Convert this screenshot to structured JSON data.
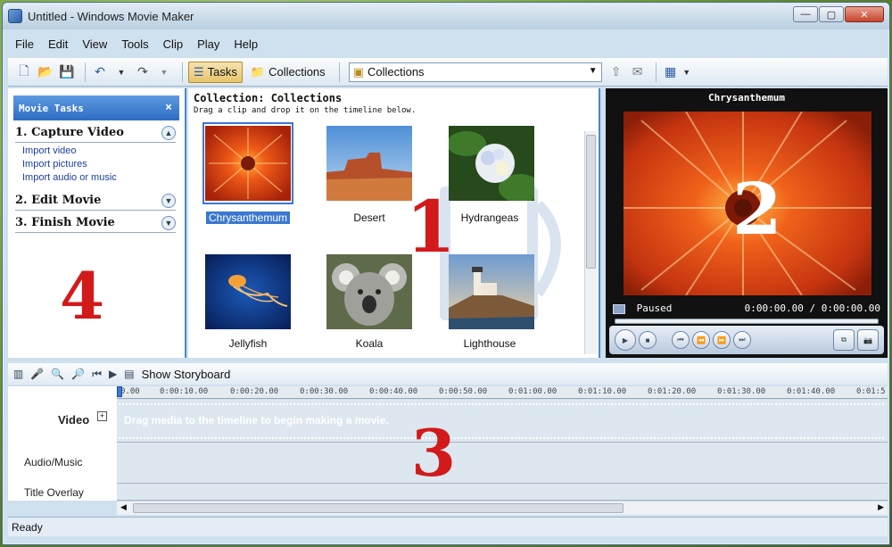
{
  "window": {
    "title": "Untitled - Windows Movie Maker",
    "minimize_label": "—",
    "maximize_label": "▢",
    "close_label": "✕"
  },
  "menu": [
    "File",
    "Edit",
    "View",
    "Tools",
    "Clip",
    "Play",
    "Help"
  ],
  "toolbar": {
    "tasks_label": "Tasks",
    "collections_label": "Collections",
    "collection_select_value": "Collections"
  },
  "tasks_pane": {
    "header": "Movie Tasks",
    "close_label": "×",
    "sections": [
      {
        "title": "1. Capture Video",
        "links": [
          "Import video",
          "Import pictures",
          "Import audio or music"
        ]
      },
      {
        "title": "2. Edit Movie",
        "links": []
      },
      {
        "title": "3. Finish Movie",
        "links": []
      }
    ]
  },
  "collection_pane": {
    "title": "Collection: Collections",
    "subtitle": "Drag a clip and drop it on the timeline below.",
    "clips": [
      {
        "name": "Chrysanthemum",
        "selected": true
      },
      {
        "name": "Desert",
        "selected": false
      },
      {
        "name": "Hydrangeas",
        "selected": false
      },
      {
        "name": "Jellyfish",
        "selected": false
      },
      {
        "name": "Koala",
        "selected": false
      },
      {
        "name": "Lighthouse",
        "selected": false
      }
    ]
  },
  "preview": {
    "title": "Chrysanthemum",
    "status": "Paused",
    "time": "0:00:00.00 / 0:00:00.00"
  },
  "annotations": {
    "n1": "1",
    "n2": "2",
    "n3": "3",
    "n4": "4"
  },
  "timeline": {
    "show_storyboard_label": "Show Storyboard",
    "ruler_ticks": [
      "0.00",
      "0:00:10.00",
      "0:00:20.00",
      "0:00:30.00",
      "0:00:40.00",
      "0:00:50.00",
      "0:01:00.00",
      "0:01:10.00",
      "0:01:20.00",
      "0:01:30.00",
      "0:01:40.00",
      "0:01:5"
    ],
    "tracks": {
      "video": "Video",
      "audio": "Audio/Music",
      "title_overlay": "Title Overlay"
    },
    "drag_message": "Drag media to the timeline to begin making a movie."
  },
  "status_bar": "Ready"
}
